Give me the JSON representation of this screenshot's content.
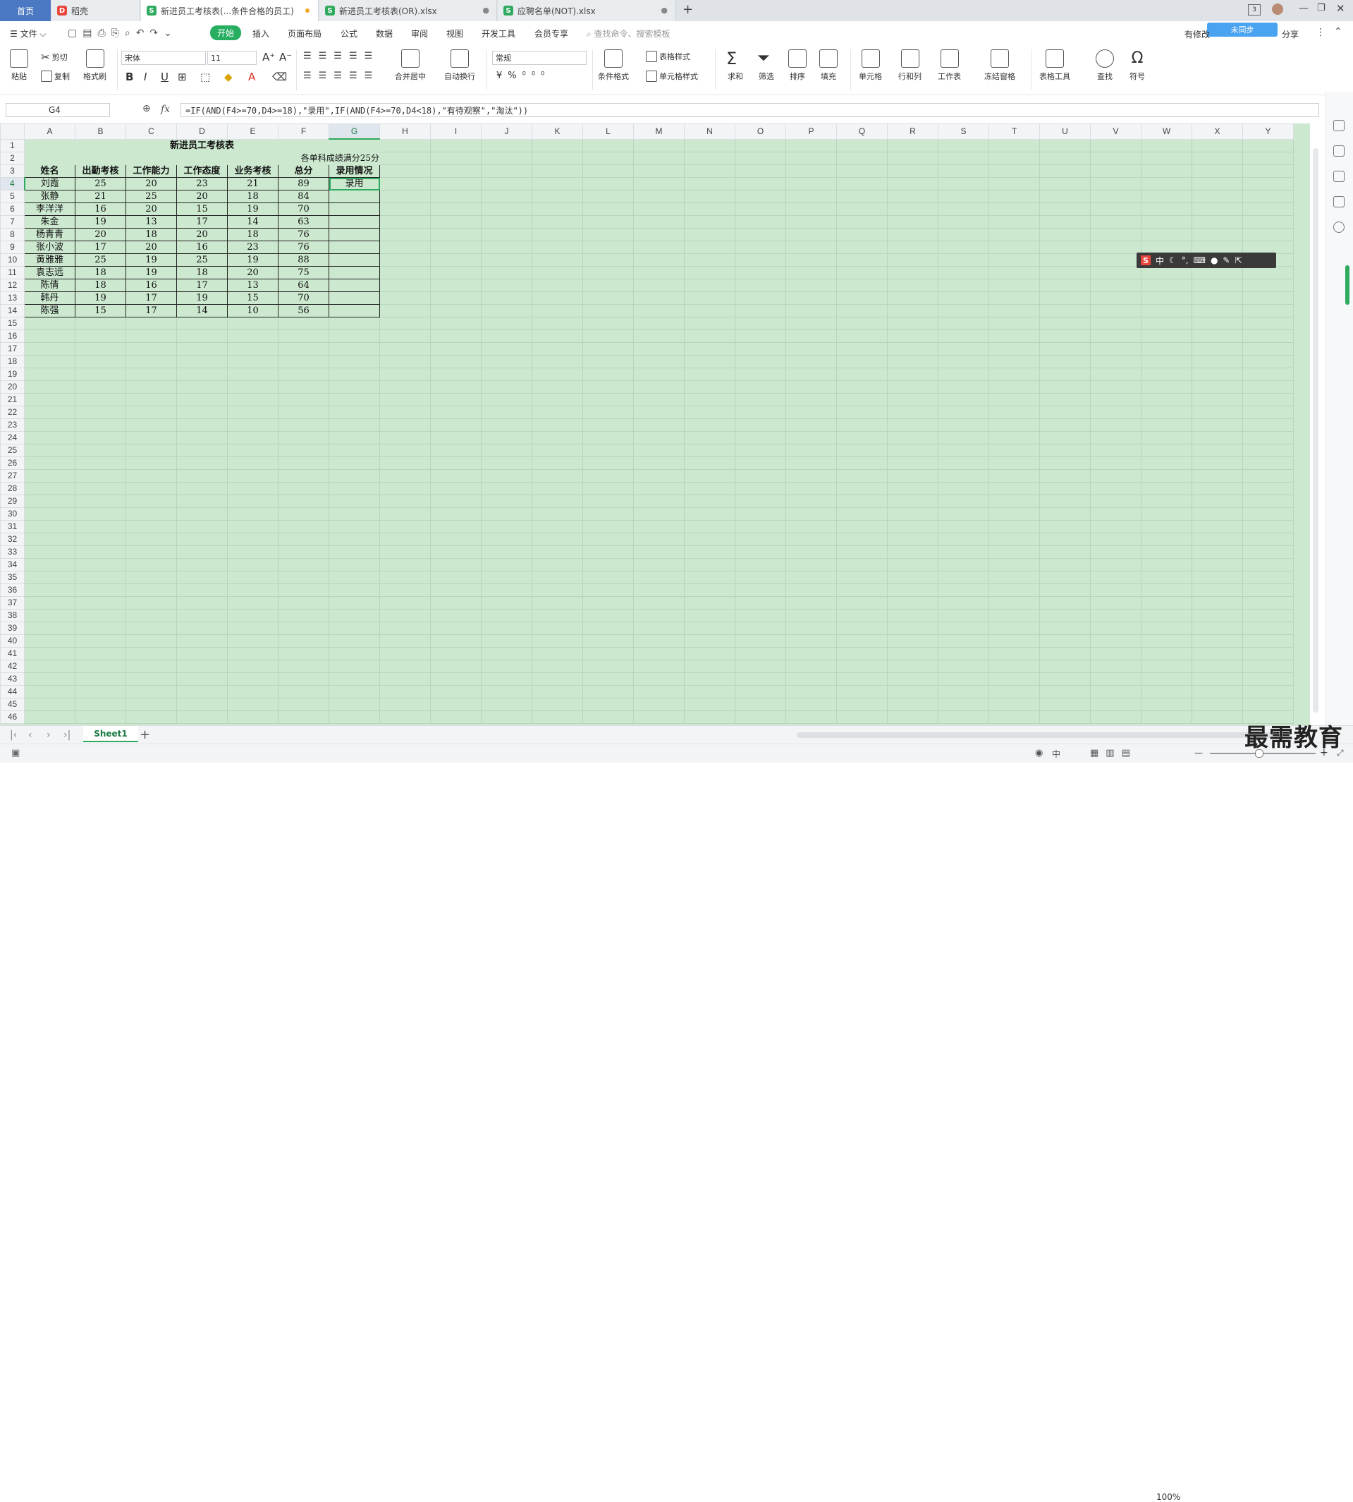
{
  "tabs": {
    "home": "首页",
    "items": [
      {
        "label": "稻壳",
        "icon": "docer-icon"
      },
      {
        "label": "新进员工考核表(...条件合格的员工)",
        "icon": "sheet-icon"
      },
      {
        "label": "新进员工考核表(OR).xlsx",
        "icon": "sheet-icon"
      },
      {
        "label": "应聘名单(NOT).xlsx",
        "icon": "sheet-icon"
      }
    ],
    "new_tab": "+",
    "tab_count": "3"
  },
  "menu": {
    "file": "文件",
    "items": [
      "开始",
      "插入",
      "页面布局",
      "公式",
      "数据",
      "审阅",
      "视图",
      "开发工具",
      "会员专享"
    ],
    "search_placeholder": "查找命令、搜索模板",
    "right": [
      "有修改",
      "分享"
    ],
    "cloud_badge": "未同步"
  },
  "ribbon": {
    "paste": "粘贴",
    "cut": "剪切",
    "copy": "复制",
    "format_painter": "格式刷",
    "font_name": "宋体",
    "font_size": "11",
    "merge_center": "合并居中",
    "wrap_text": "自动换行",
    "number_format": "常规",
    "cond_format": "条件格式",
    "table_style": "表格样式",
    "cell_style": "单元格样式",
    "sum": "求和",
    "filter": "筛选",
    "sort": "排序",
    "fill": "填充",
    "cell": "单元格",
    "row_col": "行和列",
    "worksheet": "工作表",
    "freeze": "冻结窗格",
    "table_tools": "表格工具",
    "find": "查找",
    "symbol": "符号"
  },
  "formula_bar": {
    "cell_ref": "G4",
    "fx": "fx",
    "formula": "=IF(AND(F4>=70,D4>=18),\"录用\",IF(AND(F4>=70,D4<18),\"有待观察\",\"淘汰\"))"
  },
  "sheet": {
    "columns": [
      "A",
      "B",
      "C",
      "D",
      "E",
      "F",
      "G",
      "H",
      "I",
      "J",
      "K",
      "L",
      "M",
      "N",
      "O",
      "P",
      "Q",
      "R",
      "S",
      "T",
      "U",
      "V",
      "W",
      "X",
      "Y"
    ],
    "title": "新进员工考核表",
    "note": "各单科成绩满分25分",
    "headers": [
      "姓名",
      "出勤考核",
      "工作能力",
      "工作态度",
      "业务考核",
      "总分",
      "录用情况"
    ],
    "rows": [
      [
        "刘霞",
        "25",
        "20",
        "23",
        "21",
        "89",
        "录用"
      ],
      [
        "张静",
        "21",
        "25",
        "20",
        "18",
        "84",
        ""
      ],
      [
        "李洋洋",
        "16",
        "20",
        "15",
        "19",
        "70",
        ""
      ],
      [
        "朱金",
        "19",
        "13",
        "17",
        "14",
        "63",
        ""
      ],
      [
        "杨青青",
        "20",
        "18",
        "20",
        "18",
        "76",
        ""
      ],
      [
        "张小波",
        "17",
        "20",
        "16",
        "23",
        "76",
        ""
      ],
      [
        "黄雅雅",
        "25",
        "19",
        "25",
        "19",
        "88",
        ""
      ],
      [
        "袁志远",
        "18",
        "19",
        "18",
        "20",
        "75",
        ""
      ],
      [
        "陈倩",
        "18",
        "16",
        "17",
        "13",
        "64",
        ""
      ],
      [
        "韩丹",
        "19",
        "17",
        "19",
        "15",
        "70",
        ""
      ],
      [
        "陈强",
        "15",
        "17",
        "14",
        "10",
        "56",
        ""
      ]
    ],
    "row_count": 46
  },
  "ime_bar": {
    "lang": "中"
  },
  "sheet_tabs": {
    "active": "Sheet1",
    "add": "+"
  },
  "status": {
    "zoom": "100%",
    "input_mode": "中"
  },
  "watermark": "最需教育",
  "colors": {
    "accent": "#2faa5f",
    "grid_bg": "#cce8cf",
    "home_tab": "#4a78c2"
  }
}
